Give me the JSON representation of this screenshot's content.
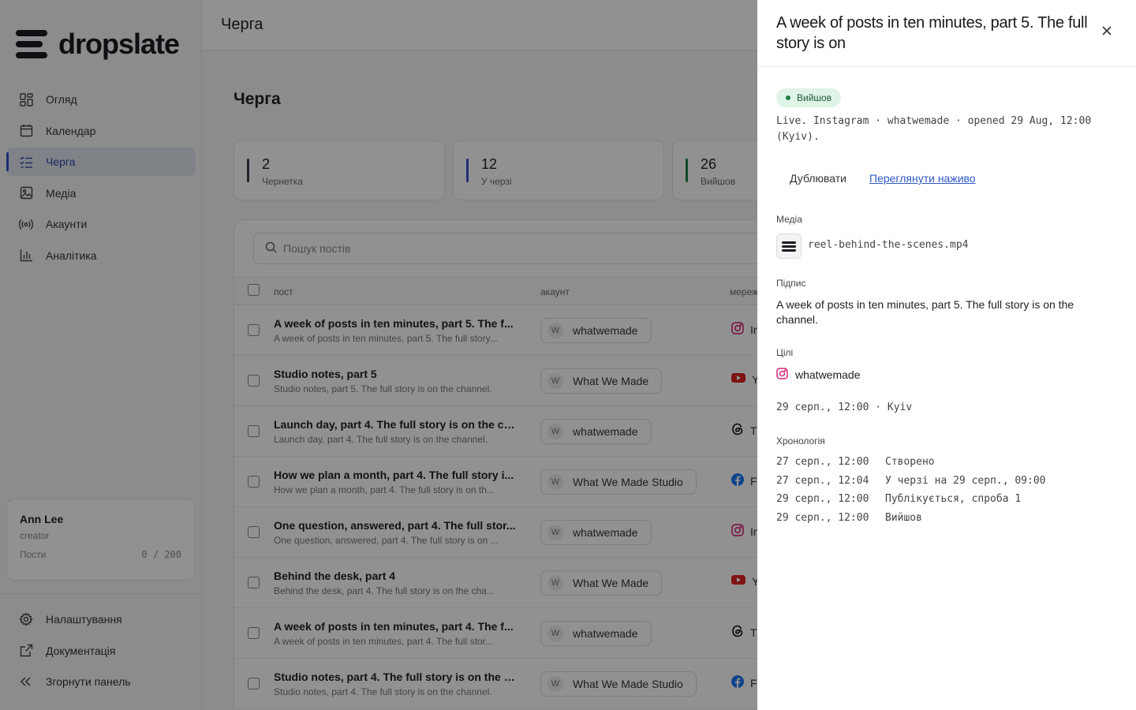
{
  "brand": {
    "name": "dropslate"
  },
  "sidebar": {
    "items": [
      {
        "label": "Огляд",
        "icon": "grid-icon"
      },
      {
        "label": "Календар",
        "icon": "calendar-icon"
      },
      {
        "label": "Черга",
        "icon": "queue-list-icon",
        "active": true
      },
      {
        "label": "Медіа",
        "icon": "image-icon"
      },
      {
        "label": "Акаунти",
        "icon": "broadcast-icon"
      },
      {
        "label": "Аналітика",
        "icon": "bar-chart-icon"
      }
    ],
    "user": {
      "name": "Ann Lee",
      "role": "creator",
      "quota_label": "Пости",
      "quota_value": "0 / 200"
    },
    "bottom": [
      {
        "label": "Налаштування",
        "icon": "gear-icon"
      },
      {
        "label": "Документація",
        "icon": "external-link-icon"
      },
      {
        "label": "Згорнути панель",
        "icon": "collapse-icon"
      }
    ]
  },
  "topbar": {
    "title": "Черга"
  },
  "page": {
    "title": "Черга"
  },
  "stats": [
    {
      "value": "2",
      "label": "Чернетка",
      "color": "#3b3f52"
    },
    {
      "value": "12",
      "label": "У черзі",
      "color": "#3652c9"
    },
    {
      "value": "26",
      "label": "Вийшов",
      "color": "#1e7d45"
    }
  ],
  "search": {
    "placeholder": "Пошук постів"
  },
  "table": {
    "columns": {
      "post": "пост",
      "account": "акаунт",
      "network": "мереж"
    },
    "rows": [
      {
        "title": "A week of posts in ten minutes, part 5. The f...",
        "sub": "A week of posts in ten minutes, part 5. The full story...",
        "account": "whatwemade",
        "network": "In",
        "network_icon": "instagram-icon"
      },
      {
        "title": "Studio notes, part 5",
        "sub": "Studio notes, part 5. The full story is on the channel.",
        "account": "What We Made",
        "network": "Y",
        "network_icon": "youtube-icon"
      },
      {
        "title": "Launch day, part 4. The full story is on the ch...",
        "sub": "Launch day, part 4. The full story is on the channel.",
        "account": "whatwemade",
        "network": "T",
        "network_icon": "threads-icon"
      },
      {
        "title": "How we plan a month, part 4. The full story i...",
        "sub": "How we plan a month, part 4. The full story is on th...",
        "account": "What We Made Studio",
        "network": "F",
        "network_icon": "facebook-icon"
      },
      {
        "title": "One question, answered, part 4. The full stor...",
        "sub": "One question, answered, part 4. The full story is on ...",
        "account": "whatwemade",
        "network": "In",
        "network_icon": "instagram-icon"
      },
      {
        "title": "Behind the desk, part 4",
        "sub": "Behind the desk, part 4. The full story is on the cha...",
        "account": "What We Made",
        "network": "Y",
        "network_icon": "youtube-icon"
      },
      {
        "title": "A week of posts in ten minutes, part 4. The f...",
        "sub": "A week of posts in ten minutes, part 4. The full stor...",
        "account": "whatwemade",
        "network": "T",
        "network_icon": "threads-icon"
      },
      {
        "title": "Studio notes, part 4. The full story is on the c...",
        "sub": "Studio notes, part 4. The full story is on the channel.",
        "account": "What We Made Studio",
        "network": "F",
        "network_icon": "facebook-icon"
      }
    ]
  },
  "drawer": {
    "title": "A week of posts in ten minutes, part 5. The full story is on",
    "status": "Вийшов",
    "live_text": "Live. Instagram · whatwemade · opened 29 Aug, 12:00 (Kyiv).",
    "duplicate_label": "Дублювати",
    "view_live_label": "Переглянути наживо",
    "media_label": "Медіа",
    "media_file": "reel-behind-the-scenes.mp4",
    "caption_label": "Підпис",
    "caption": "A week of posts in ten minutes, part 5. The full story is on the channel.",
    "targets_label": "Цілі",
    "target_account": "whatwemade",
    "schedule": "29 серп., 12:00 · Kyiv",
    "timeline_label": "Хронологія",
    "timeline": [
      {
        "date": "27 серп., 12:00",
        "event": "Створено"
      },
      {
        "date": "27 серп., 12:04",
        "event": "У черзі на 29 серп., 09:00"
      },
      {
        "date": "29 серп., 12:00",
        "event": "Публікується, спроба 1"
      },
      {
        "date": "29 серп., 12:00",
        "event": "Вийшов"
      }
    ]
  }
}
